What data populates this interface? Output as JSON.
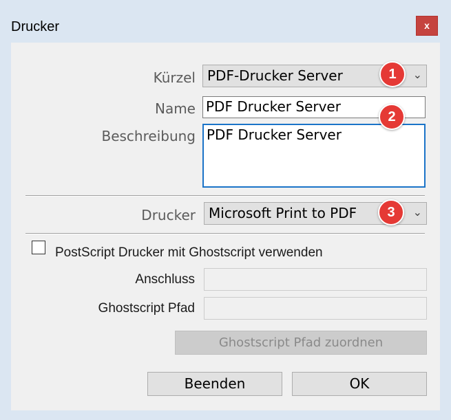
{
  "window": {
    "title": "Drucker",
    "close_label": "x"
  },
  "fields": {
    "kuerzel": {
      "label": "Kürzel",
      "value": "PDF-Drucker Server"
    },
    "name": {
      "label": "Name",
      "value": "PDF Drucker Server"
    },
    "beschreibung": {
      "label": "Beschreibung",
      "value": "PDF Drucker Server"
    },
    "drucker": {
      "label": "Drucker",
      "value": "Microsoft Print to PDF"
    }
  },
  "ghostscript": {
    "checkbox_label": "PostScript Drucker mit Ghostscript verwenden",
    "checked": false,
    "anschluss_label": "Anschluss",
    "anschluss_value": "",
    "pfad_label": "Ghostscript Pfad",
    "pfad_value": "",
    "assign_button": "Ghostscript Pfad zuordnen"
  },
  "buttons": {
    "close": "Beenden",
    "ok": "OK"
  },
  "badges": [
    "1",
    "2",
    "3"
  ],
  "icons": {
    "dropdown": "chevron-down-icon"
  },
  "colors": {
    "badge": "#e53935",
    "focus_border": "#1a73c8",
    "close_button": "#c5433f"
  }
}
